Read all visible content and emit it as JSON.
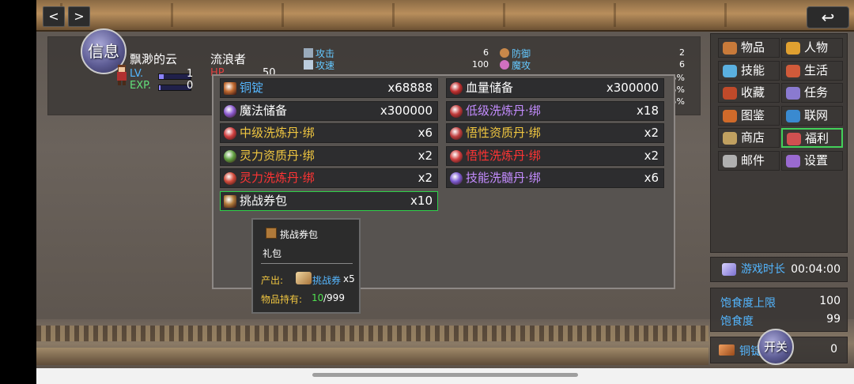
{
  "nav": {
    "prev": "<",
    "next": ">",
    "back": "↩"
  },
  "status": {
    "info_label": "信息",
    "name": "飘渺的云",
    "title": "流浪者",
    "lv_label": "LV.",
    "lv_value": "1",
    "exp_label": "EXP.",
    "exp_value": "0",
    "hp_label": "HP",
    "hp_value": "50",
    "lv_fill": 0.15,
    "exp_fill": 0.05,
    "stats_left": [
      {
        "label": "攻击",
        "value": "6"
      },
      {
        "label": "攻速",
        "value": "100"
      }
    ],
    "stats_right": [
      {
        "label": "防御",
        "value": "2"
      },
      {
        "label": "魔攻",
        "value": "6"
      }
    ],
    "pct_values": [
      "5%",
      "95%",
      "5%"
    ]
  },
  "menu": [
    {
      "label": "物品"
    },
    {
      "label": "人物"
    },
    {
      "label": "技能"
    },
    {
      "label": "生活"
    },
    {
      "label": "收藏"
    },
    {
      "label": "任务"
    },
    {
      "label": "图鉴"
    },
    {
      "label": "联网"
    },
    {
      "label": "商店"
    },
    {
      "label": "福利"
    },
    {
      "label": "邮件"
    },
    {
      "label": "设置"
    }
  ],
  "play_time": {
    "label": "游戏时长",
    "value": "00:04:00"
  },
  "hunger": {
    "max_label": "饱食度上限",
    "max_value": "100",
    "cur_label": "饱食度",
    "cur_value": "99"
  },
  "currency": {
    "label": "铜锭",
    "value": "0",
    "switch_label": "开关"
  },
  "inventory": [
    {
      "name": "铜锭",
      "qty": "x68888",
      "color": "blue"
    },
    {
      "name": "血量储备",
      "qty": "x300000",
      "color": "white"
    },
    {
      "name": "魔法储备",
      "qty": "x300000",
      "color": "white"
    },
    {
      "name": "低级洗炼丹·绑",
      "qty": "x18",
      "color": "purple"
    },
    {
      "name": "中级洗炼丹·绑",
      "qty": "x6",
      "color": "yellow"
    },
    {
      "name": "悟性资质丹·绑",
      "qty": "x2",
      "color": "yellow"
    },
    {
      "name": "灵力资质丹·绑",
      "qty": "x2",
      "color": "yellow"
    },
    {
      "name": "悟性洗炼丹·绑",
      "qty": "x2",
      "color": "red"
    },
    {
      "name": "灵力洗炼丹·绑",
      "qty": "x2",
      "color": "red"
    },
    {
      "name": "技能洗髓丹·绑",
      "qty": "x6",
      "color": "purple"
    },
    {
      "name": "挑战券包",
      "qty": "x10",
      "color": "white"
    }
  ],
  "tooltip": {
    "title": "挑战券包",
    "type": "礼包",
    "produce_label": "产出:",
    "produce_item": "挑战券",
    "produce_qty": "x5",
    "hold_label": "物品持有:",
    "hold_current": "10",
    "hold_max": "/999"
  },
  "colors": {
    "accent_green": "#2fd14a",
    "blue_text": "#56b7ff",
    "yellow_text": "#f0c640",
    "purple_text": "#c48cff",
    "red_text": "#ff3434"
  }
}
